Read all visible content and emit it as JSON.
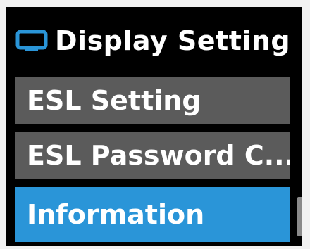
{
  "header": {
    "title": "Display Setting",
    "icon": "display-icon"
  },
  "menu": {
    "items": [
      {
        "label": "ESL Setting",
        "selected": false
      },
      {
        "label": "ESL Password C...",
        "selected": false
      },
      {
        "label": "Information",
        "selected": true
      }
    ]
  },
  "colors": {
    "background": "#000000",
    "item": "#5b5b5b",
    "selected": "#2a95d8",
    "icon": "#2a95d8",
    "scrollbar": "#8a8a8a"
  }
}
